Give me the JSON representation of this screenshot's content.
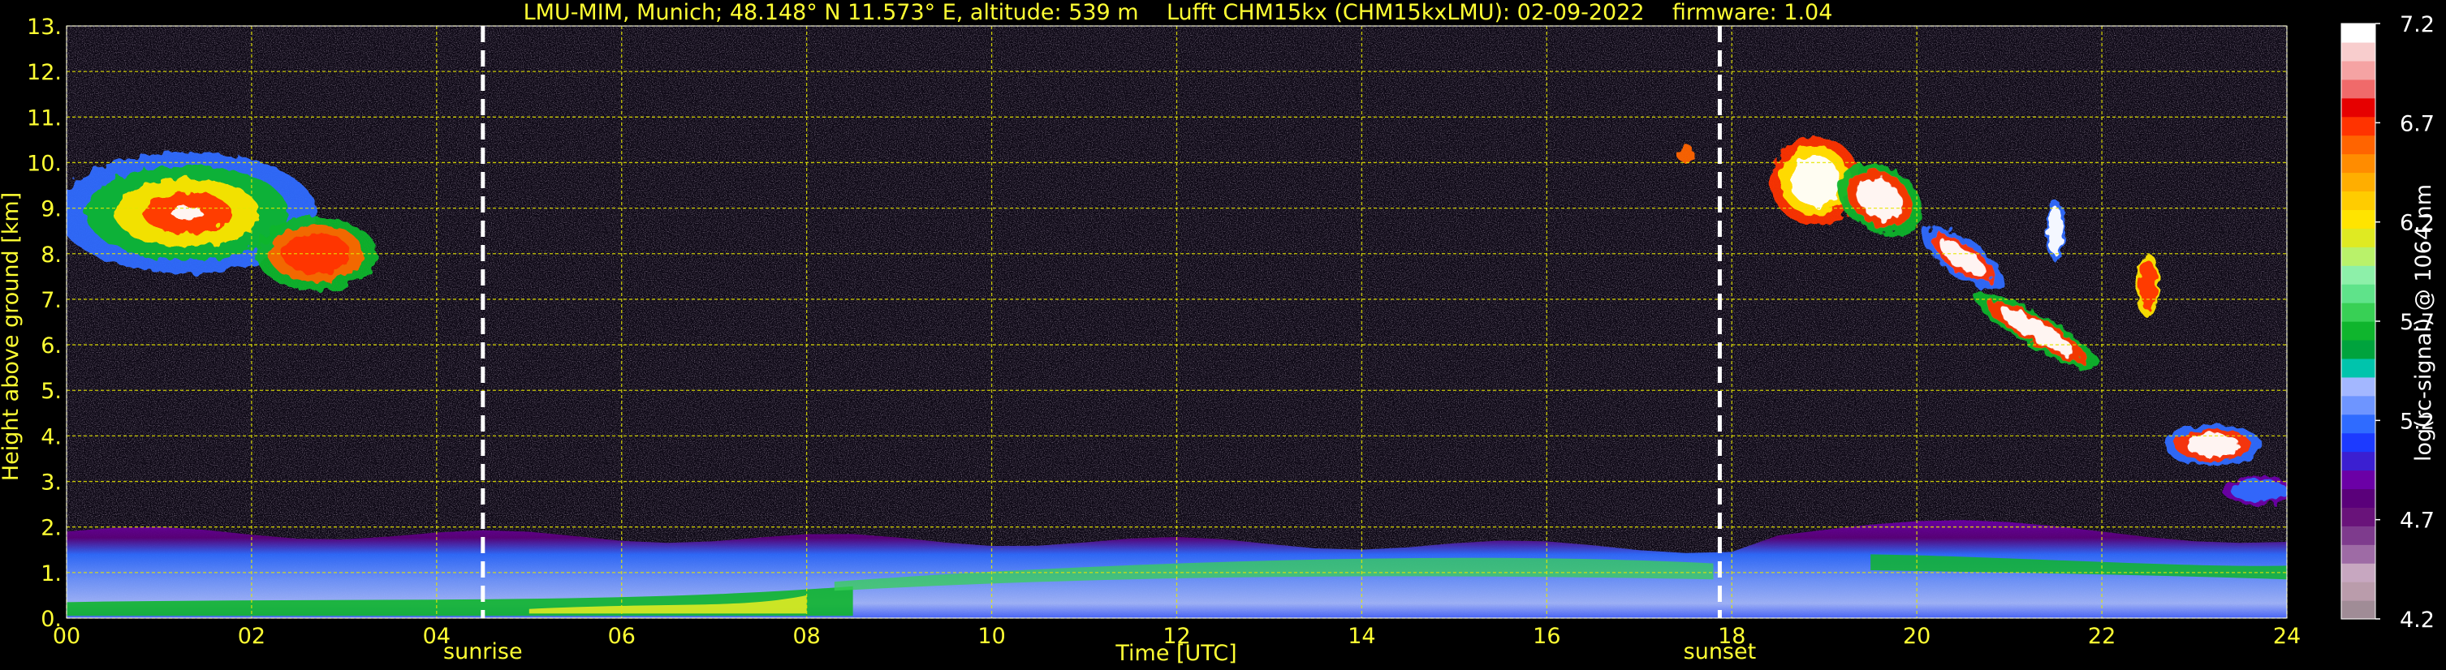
{
  "chart_data": {
    "type": "heatmap",
    "title": "LMU-MIM, Munich; 48.148° N 11.573° E, altitude: 539 m    Lufft CHM15kx (CHM15kxLMU): 02-09-2022    firmware: 1.04",
    "xlabel": "Time [UTC]",
    "ylabel": "Height above ground [km]",
    "xlim": [
      0,
      24
    ],
    "ylim": [
      0,
      13
    ],
    "x_ticks": [
      "00",
      "02",
      "04",
      "06",
      "08",
      "10",
      "12",
      "14",
      "16",
      "18",
      "20",
      "22",
      "24"
    ],
    "y_ticks": [
      "0.",
      "1.",
      "2.",
      "3.",
      "4.",
      "5.",
      "6.",
      "7.",
      "8.",
      "9.",
      "10.",
      "11.",
      "12.",
      "13."
    ],
    "grid": true,
    "colorbar": {
      "label": "log(rc-signal) @ 1064 nm",
      "range": [
        4.2,
        7.2
      ],
      "ticks": [
        "4.2",
        "4.7",
        "5.2",
        "5.7",
        "6.2",
        "6.7",
        "7.2"
      ],
      "colors": [
        "#a08c96",
        "#ba9cab",
        "#c7a7c0",
        "#9e6ba5",
        "#7e3b8d",
        "#69137a",
        "#5a007a",
        "#6b00a6",
        "#3b1fd1",
        "#1c3aff",
        "#2f6bff",
        "#6e95ff",
        "#a3b7ff",
        "#00c4ac",
        "#00a33d",
        "#0fb52d",
        "#38d055",
        "#5fe38a",
        "#8df0a9",
        "#b9f26a",
        "#dfea22",
        "#ffe400",
        "#ffcc00",
        "#ffae00",
        "#ff8c00",
        "#ff6400",
        "#ff3300",
        "#e60000",
        "#f06a6a",
        "#f5a3a3",
        "#f8cdcd",
        "#ffffff"
      ]
    },
    "annotations": [
      {
        "label": "sunrise",
        "x": 4.5
      },
      {
        "label": "sunset",
        "x": 17.87
      }
    ]
  }
}
